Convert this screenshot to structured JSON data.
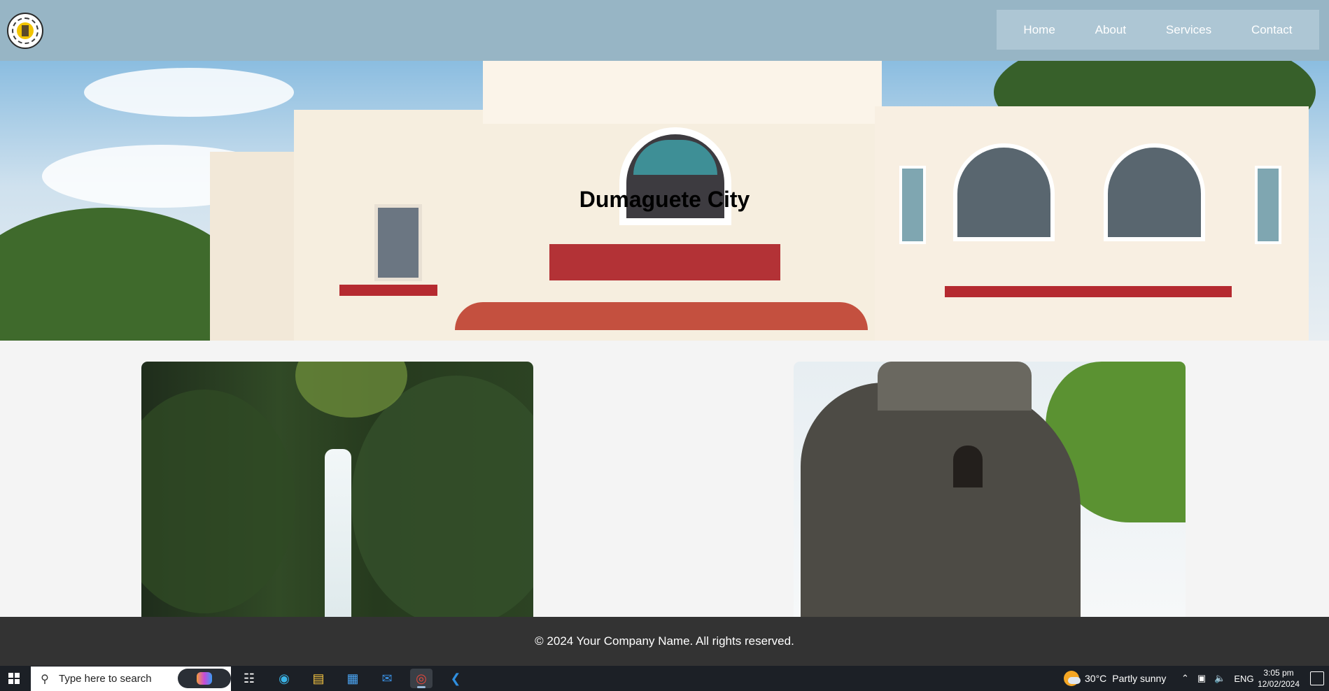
{
  "header": {
    "logo_icon": "city-seal-icon",
    "nav": [
      "Home",
      "About",
      "Services",
      "Contact"
    ]
  },
  "hero": {
    "title": "Dumaguete City"
  },
  "cards": [
    {
      "image": "waterfall-photo"
    },
    {
      "image": "bell-tower-photo"
    }
  ],
  "footer": {
    "text": "© 2024 Your Company Name. All rights reserved."
  },
  "taskbar": {
    "search_placeholder": "Type here to search",
    "weather_temp": "30°C",
    "weather_desc": "Partly sunny",
    "language": "ENG",
    "time": "3:05 pm",
    "date": "12/02/2024",
    "apps": [
      "task-view-icon",
      "edge-icon",
      "file-explorer-icon",
      "store-icon",
      "mail-icon",
      "chrome-icon",
      "vscode-icon"
    ]
  },
  "colors": {
    "header_bg": "#97b5c5",
    "nav_bg": "#adc6d4",
    "footer_bg": "#333333",
    "taskbar_bg": "#1c2026"
  }
}
